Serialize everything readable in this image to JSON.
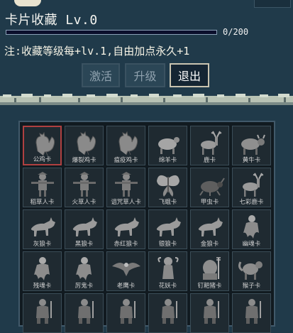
{
  "header": {
    "title": "卡片收藏 Lv.0",
    "progress": {
      "value": 0,
      "max": 200,
      "text": "0/200"
    },
    "note": "注:收藏等级每+lv.1,自由加点永久+1"
  },
  "buttons": {
    "activate": "激活",
    "upgrade": "升级",
    "exit": "退出"
  },
  "cards": [
    {
      "label": "公鸡卡",
      "icon": "rooster-icon",
      "selected": true
    },
    {
      "label": "爆裂鸡卡",
      "icon": "rooster-icon"
    },
    {
      "label": "瘟疫鸡卡",
      "icon": "rooster-icon"
    },
    {
      "label": "绵羊卡",
      "icon": "sheep-icon"
    },
    {
      "label": "鹿卡",
      "icon": "deer-icon"
    },
    {
      "label": "黄牛卡",
      "icon": "ox-icon"
    },
    {
      "label": "稻草人卡",
      "icon": "scarecrow-icon"
    },
    {
      "label": "火草人卡",
      "icon": "scarecrow-icon"
    },
    {
      "label": "诅咒草人卡",
      "icon": "scarecrow-icon"
    },
    {
      "label": "飞蛾卡",
      "icon": "moth-icon"
    },
    {
      "label": "甲虫卡",
      "icon": "beetle-icon"
    },
    {
      "label": "七彩鹿卡",
      "icon": "deer-icon"
    },
    {
      "label": "灰狼卡",
      "icon": "wolf-icon"
    },
    {
      "label": "黑狼卡",
      "icon": "wolf-icon"
    },
    {
      "label": "赤红狼卡",
      "icon": "wolf-icon"
    },
    {
      "label": "银狼卡",
      "icon": "wolf-icon"
    },
    {
      "label": "金狼卡",
      "icon": "wolf-icon"
    },
    {
      "label": "幽魂卡",
      "icon": "ghost-icon"
    },
    {
      "label": "残魂卡",
      "icon": "ghost-icon"
    },
    {
      "label": "厉鬼卡",
      "icon": "ghost-icon"
    },
    {
      "label": "老鹰卡",
      "icon": "eagle-icon"
    },
    {
      "label": "花妖卡",
      "icon": "flower-demon-icon"
    },
    {
      "label": "钉耙猪卡",
      "icon": "pig-icon"
    },
    {
      "label": "猴子卡",
      "icon": "monkey-icon"
    },
    {
      "label": "",
      "icon": "warrior-icon"
    },
    {
      "label": "",
      "icon": "warrior-icon"
    },
    {
      "label": "",
      "icon": "warrior-icon"
    },
    {
      "label": "",
      "icon": "warrior-icon"
    },
    {
      "label": "",
      "icon": "warrior-icon"
    },
    {
      "label": "",
      "icon": "warrior-icon"
    }
  ]
}
